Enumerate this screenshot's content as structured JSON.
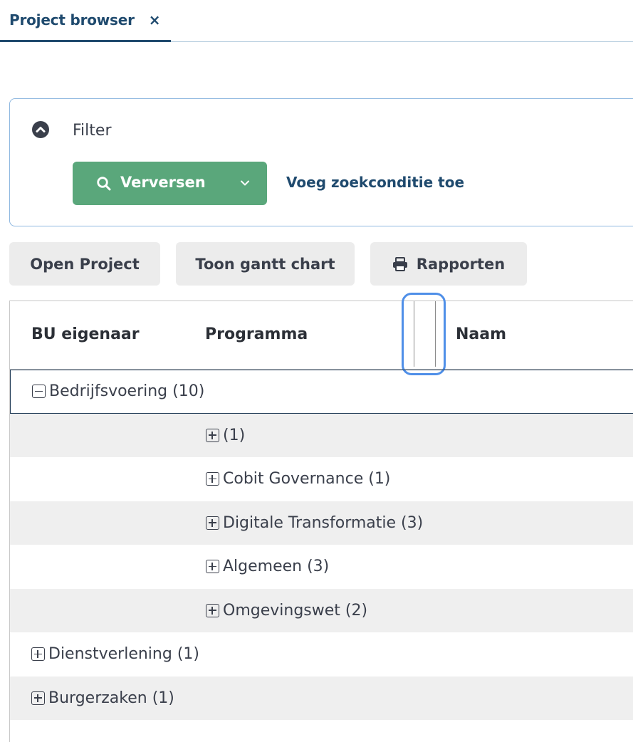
{
  "tabs": [
    {
      "label": "Project browser",
      "close": "×"
    }
  ],
  "filter": {
    "label": "Filter",
    "refresh_label": "Verversen",
    "add_condition_label": "Voeg zoekconditie toe"
  },
  "toolbar": {
    "open_project": "Open Project",
    "gantt": "Toon gantt chart",
    "reports": "Rapporten"
  },
  "grid": {
    "columns": [
      "BU eigenaar",
      "Programma",
      "Naam"
    ],
    "rows": [
      {
        "label": "Bedrijfsvoering (10)",
        "level": 0,
        "expanded": true
      },
      {
        "label": "(1)",
        "level": 1,
        "expanded": false
      },
      {
        "label": "Cobit Governance (1)",
        "level": 1,
        "expanded": false
      },
      {
        "label": "Digitale Transformatie (3)",
        "level": 1,
        "expanded": false
      },
      {
        "label": "Algemeen (3)",
        "level": 1,
        "expanded": false
      },
      {
        "label": "Omgevingswet (2)",
        "level": 1,
        "expanded": false
      },
      {
        "label": "Dienstverlening (1)",
        "level": 0,
        "expanded": false
      },
      {
        "label": "Burgerzaken (1)",
        "level": 0,
        "expanded": false
      }
    ]
  },
  "colors": {
    "accent": "#1f4a6e",
    "refresh_button": "#5aa77b",
    "filter_border": "#8fb8e0",
    "resize_highlight": "#4f8fe8",
    "row_alt": "#efefef"
  },
  "icons": {
    "filter_toggle": "chevron-up-circle-icon",
    "refresh": "search-icon",
    "refresh_menu": "chevron-down-icon",
    "reports": "printer-icon",
    "expanded_group": "minus-square-icon",
    "collapsed_group": "plus-square-icon"
  }
}
